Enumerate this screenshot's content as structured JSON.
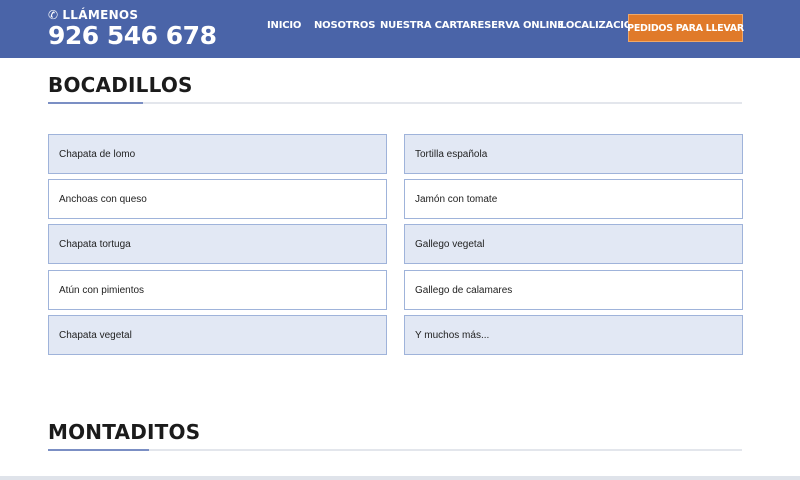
{
  "header": {
    "call_label": "LLÁMENOS",
    "phone_number": "926 546 678",
    "phone_icon": "phone-icon",
    "background_color": "#4a64a8"
  },
  "nav": {
    "items": [
      {
        "label": "INICIO"
      },
      {
        "label": "NOSOTROS"
      },
      {
        "label": "NUESTRA CARTA"
      },
      {
        "label": "RESERVA ONLINE"
      },
      {
        "label": "LOCALIZACION"
      }
    ],
    "cta_label": "PEDIDOS PARA LLEVAR",
    "cta_color": "#e07a2a"
  },
  "sections": [
    {
      "title": "BOCADILLOS",
      "items_left": [
        "Chapata de lomo",
        "Anchoas con queso",
        "Chapata tortuga",
        "Atún con pimientos",
        "Chapata vegetal"
      ],
      "items_right": [
        "Tortilla española",
        "Jamón con tomate",
        "Gallego vegetal",
        "Gallego de calamares",
        "Y muchos más..."
      ]
    },
    {
      "title": "MONTADITOS"
    }
  ]
}
